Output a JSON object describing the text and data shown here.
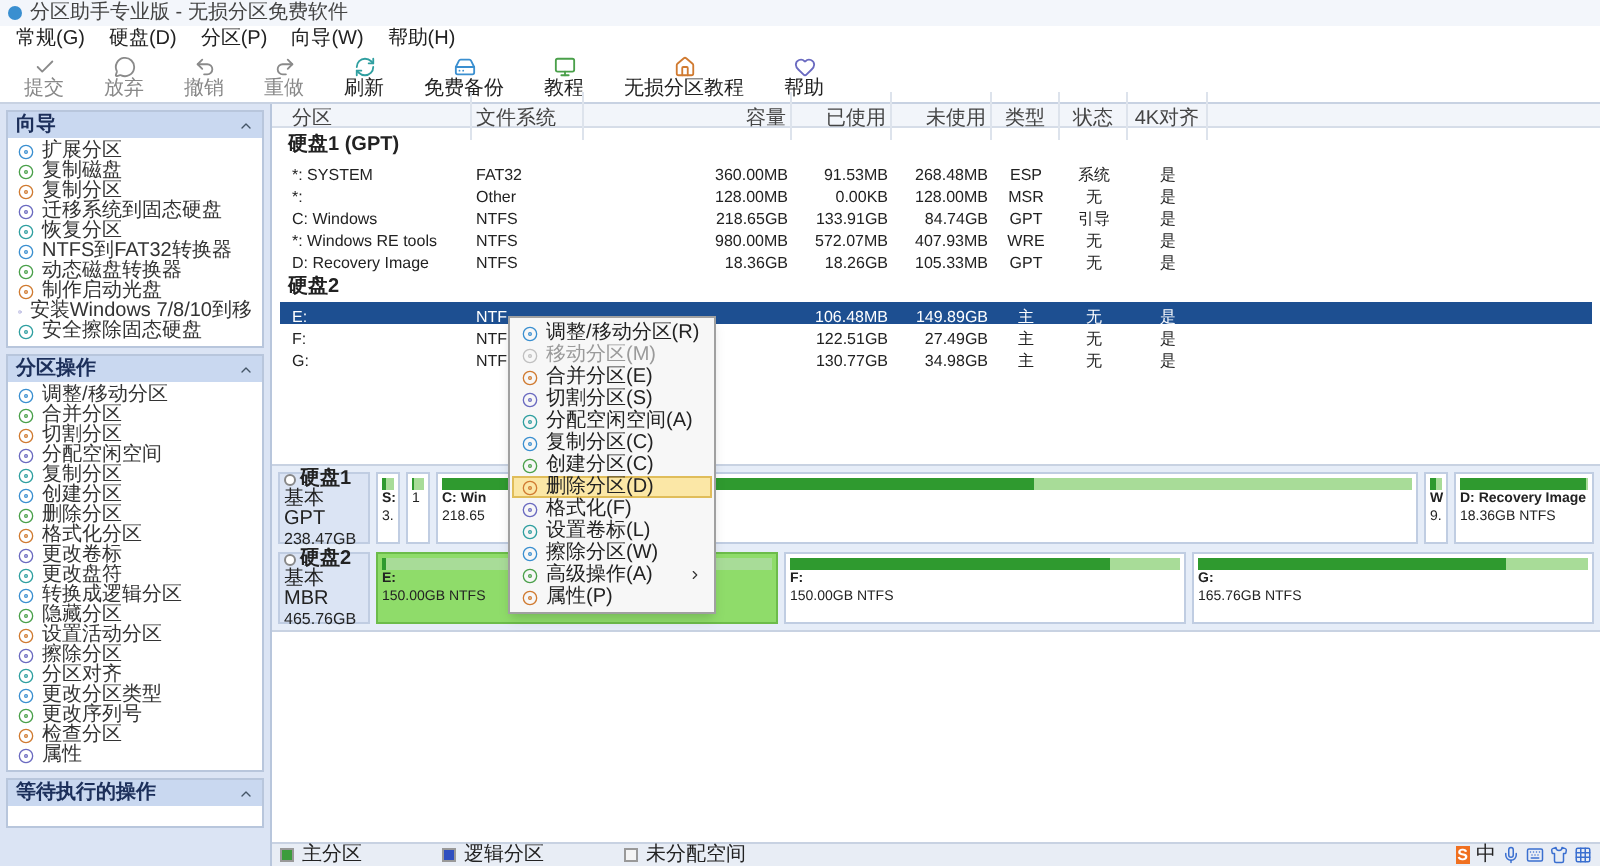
{
  "window": {
    "title": "分区助手专业版 - 无损分区免费软件"
  },
  "menu": [
    "常规(G)",
    "硬盘(D)",
    "分区(P)",
    "向导(W)",
    "帮助(H)"
  ],
  "toolbar": [
    {
      "label": "提交",
      "disabled": true
    },
    {
      "label": "放弃",
      "disabled": true
    },
    {
      "label": "撤销",
      "disabled": true
    },
    {
      "label": "重做",
      "disabled": true
    },
    {
      "label": "刷新",
      "disabled": false
    },
    {
      "label": "免费备份",
      "disabled": false
    },
    {
      "label": "教程",
      "disabled": false
    },
    {
      "label": "无损分区教程",
      "disabled": false
    },
    {
      "label": "帮助",
      "disabled": false
    }
  ],
  "sidebar": [
    {
      "title": "向导",
      "items": [
        "扩展分区",
        "复制磁盘",
        "复制分区",
        "迁移系统到固态硬盘",
        "恢复分区",
        "NTFS到FAT32转换器",
        "动态磁盘转换器",
        "制作启动光盘",
        "安装Windows 7/8/10到移",
        "安全擦除固态硬盘"
      ]
    },
    {
      "title": "分区操作",
      "items": [
        "调整/移动分区",
        "合并分区",
        "切割分区",
        "分配空闲空间",
        "复制分区",
        "创建分区",
        "删除分区",
        "格式化分区",
        "更改卷标",
        "更改盘符",
        "转换成逻辑分区",
        "隐藏分区",
        "设置活动分区",
        "擦除分区",
        "分区对齐",
        "更改分区类型",
        "更改序列号",
        "检查分区",
        "属性"
      ]
    },
    {
      "title": "等待执行的操作"
    }
  ],
  "table": {
    "columns": [
      "分区",
      "文件系统",
      "容量",
      "已使用",
      "未使用",
      "类型",
      "状态",
      "4K对齐"
    ],
    "disks": [
      {
        "label": "硬盘1 (GPT)",
        "rows": [
          {
            "cells": [
              "*: SYSTEM",
              "FAT32",
              "360.00MB",
              "91.53MB",
              "268.48MB",
              "ESP",
              "系统",
              "是"
            ],
            "selected": false
          },
          {
            "cells": [
              "*:",
              "Other",
              "128.00MB",
              "0.00KB",
              "128.00MB",
              "MSR",
              "无",
              "是"
            ],
            "selected": false
          },
          {
            "cells": [
              "C: Windows",
              "NTFS",
              "218.65GB",
              "133.91GB",
              "84.74GB",
              "GPT",
              "引导",
              "是"
            ],
            "selected": false
          },
          {
            "cells": [
              "*: Windows RE tools",
              "NTFS",
              "980.00MB",
              "572.07MB",
              "407.93MB",
              "WRE",
              "无",
              "是"
            ],
            "selected": false
          },
          {
            "cells": [
              "D: Recovery Image",
              "NTFS",
              "18.36GB",
              "18.26GB",
              "105.33MB",
              "GPT",
              "无",
              "是"
            ],
            "selected": false
          }
        ]
      },
      {
        "label": "硬盘2",
        "rows": [
          {
            "cells": [
              "E:",
              "NTF",
              null,
              "106.48MB",
              "149.89GB",
              "主",
              "无",
              "是"
            ],
            "selected": true
          },
          {
            "cells": [
              "F:",
              "NTF",
              null,
              "122.51GB",
              "27.49GB",
              "主",
              "无",
              "是"
            ],
            "selected": false
          },
          {
            "cells": [
              "G:",
              "NTF",
              null,
              "130.77GB",
              "34.98GB",
              "主",
              "无",
              "是"
            ],
            "selected": false
          }
        ]
      }
    ]
  },
  "context_menu": [
    {
      "label": "调整/移动分区(R)",
      "disabled": false,
      "selected": false,
      "submenu": false
    },
    {
      "label": "移动分区(M)",
      "disabled": true,
      "selected": false,
      "submenu": false
    },
    {
      "label": "合并分区(E)",
      "disabled": false,
      "selected": false,
      "submenu": false
    },
    {
      "label": "切割分区(S)",
      "disabled": false,
      "selected": false,
      "submenu": false
    },
    {
      "label": "分配空闲空间(A)",
      "disabled": false,
      "selected": false,
      "submenu": false
    },
    {
      "label": "复制分区(C)",
      "disabled": false,
      "selected": false,
      "submenu": false
    },
    {
      "label": "创建分区(C)",
      "disabled": false,
      "selected": false,
      "submenu": false
    },
    {
      "label": "删除分区(D)",
      "disabled": false,
      "selected": true,
      "submenu": false
    },
    {
      "label": "格式化(F)",
      "disabled": false,
      "selected": false,
      "submenu": false
    },
    {
      "label": "设置卷标(L)",
      "disabled": false,
      "selected": false,
      "submenu": false
    },
    {
      "label": "擦除分区(W)",
      "disabled": false,
      "selected": false,
      "submenu": false
    },
    {
      "label": "高级操作(A)",
      "disabled": false,
      "selected": false,
      "submenu": true
    },
    {
      "label": "属性(P)",
      "disabled": false,
      "selected": false,
      "submenu": false
    }
  ],
  "disk_map": [
    {
      "name": "硬盘1",
      "type": "基本 GPT",
      "size": "238.47GB",
      "partitions": [
        {
          "kind": "narrow",
          "label": "S:",
          "size": "3.",
          "level": 0.3,
          "selected": false
        },
        {
          "kind": "narrow",
          "size": "1",
          "level": 0.05,
          "selected": false
        },
        {
          "kind": "wide",
          "label": "C: Win",
          "size": "218.65",
          "level": 0.61,
          "selected": false
        },
        {
          "kind": "narrow",
          "label": "W",
          "size": "9.",
          "level": 0.58,
          "selected": false
        },
        {
          "kind": "fixed",
          "label": "D: Recovery Image",
          "size": "18.36GB NTFS",
          "level": 0.99,
          "selected": false
        }
      ]
    },
    {
      "name": "硬盘2",
      "type": "基本 MBR",
      "size": "465.76GB",
      "partitions": [
        {
          "kind": "wide",
          "label": "E:",
          "size": "150.00GB NTFS",
          "level": 0.01,
          "selected": true
        },
        {
          "kind": "wide",
          "label": "F:",
          "size": "150.00GB NTFS",
          "level": 0.82,
          "selected": false
        },
        {
          "kind": "wide",
          "label": "G:",
          "size": "165.76GB NTFS",
          "level": 0.79,
          "selected": false
        }
      ]
    }
  ],
  "legend": [
    {
      "label": "主分区",
      "color": "#3c9c3c"
    },
    {
      "label": "逻辑分区",
      "color": "#2f4fc0"
    },
    {
      "label": "未分配空间",
      "color": "#f4f4f4"
    }
  ],
  "ime": [
    "S",
    "中"
  ]
}
